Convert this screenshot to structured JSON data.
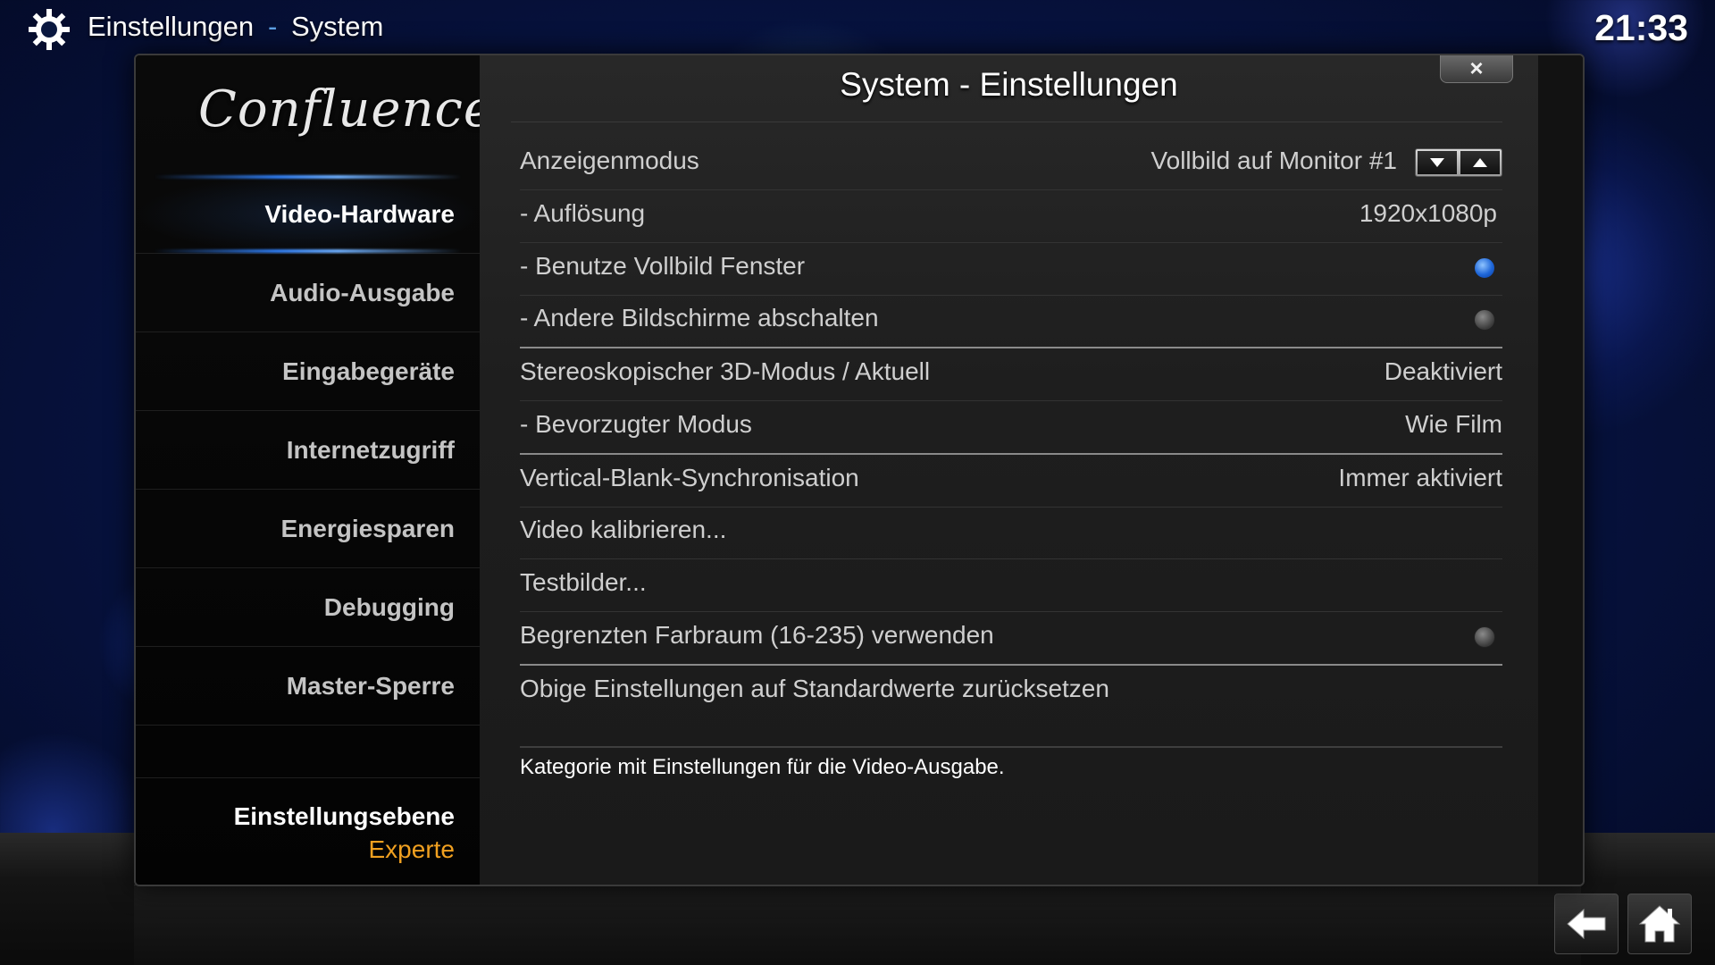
{
  "header": {
    "title": "Einstellungen",
    "separator": "-",
    "subtitle": "System",
    "clock": "21:33",
    "icon": "gear-icon"
  },
  "dialog": {
    "logo_text": "Confluence",
    "title": "System - Einstellungen",
    "close_label": "×"
  },
  "sidebar": {
    "items": [
      {
        "label": "Video-Hardware",
        "active": true
      },
      {
        "label": "Audio-Ausgabe"
      },
      {
        "label": "Eingabegeräte"
      },
      {
        "label": "Internetzugriff"
      },
      {
        "label": "Energiesparen"
      },
      {
        "label": "Debugging"
      },
      {
        "label": "Master-Sperre"
      }
    ],
    "level_label": "Einstellungsebene",
    "level_value": "Experte"
  },
  "settings": [
    {
      "label": "Anzeigenmodus",
      "value": "Vollbild auf Monitor #1",
      "control": "spinner"
    },
    {
      "label": "- Auflösung",
      "value": "1920x1080p",
      "control": "text"
    },
    {
      "label": "- Benutze Vollbild Fenster",
      "value": "",
      "control": "radio",
      "checked": true
    },
    {
      "label": "- Andere Bildschirme abschalten",
      "value": "",
      "control": "radio",
      "checked": false
    },
    {
      "label": "Stereoskopischer 3D-Modus / Aktuell",
      "value": "Deaktiviert",
      "control": "text"
    },
    {
      "label": "- Bevorzugter Modus",
      "value": "Wie Film",
      "control": "text"
    },
    {
      "label": "Vertical-Blank-Synchronisation",
      "value": "Immer aktiviert",
      "control": "text"
    },
    {
      "label": "Video kalibrieren...",
      "value": "",
      "control": "action"
    },
    {
      "label": "Testbilder...",
      "value": "",
      "control": "action"
    },
    {
      "label": "Begrenzten Farbraum (16-235) verwenden",
      "value": "",
      "control": "radio",
      "checked": false
    },
    {
      "label": "Obige Einstellungen auf Standardwerte zurücksetzen",
      "value": "",
      "control": "action"
    }
  ],
  "description": "Kategorie mit Einstellungen für die Video-Ausgabe.",
  "colors": {
    "accent": "#2f7cf0",
    "level_value": "#f0a020",
    "radio_on": "#1e66d8"
  },
  "bottom": {
    "back_icon": "back-arrow-icon",
    "home_icon": "home-icon"
  }
}
